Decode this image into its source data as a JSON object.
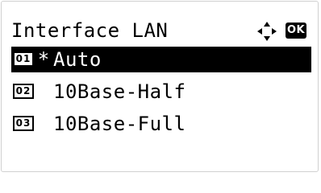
{
  "header": {
    "title": "Interface LAN",
    "ok_label": "OK"
  },
  "menu": {
    "items": [
      {
        "number": "01",
        "marker": "*",
        "label": "Auto",
        "selected": true
      },
      {
        "number": "02",
        "marker": "",
        "label": "10Base-Half",
        "selected": false
      },
      {
        "number": "03",
        "marker": "",
        "label": "10Base-Full",
        "selected": false
      }
    ]
  },
  "icons": {
    "navigation": "four-way-arrows-icon",
    "ok": "ok-badge-icon"
  },
  "colors": {
    "highlight": "#000000",
    "highlight_text": "#ffffff",
    "text": "#000000",
    "background": "#ffffff"
  }
}
